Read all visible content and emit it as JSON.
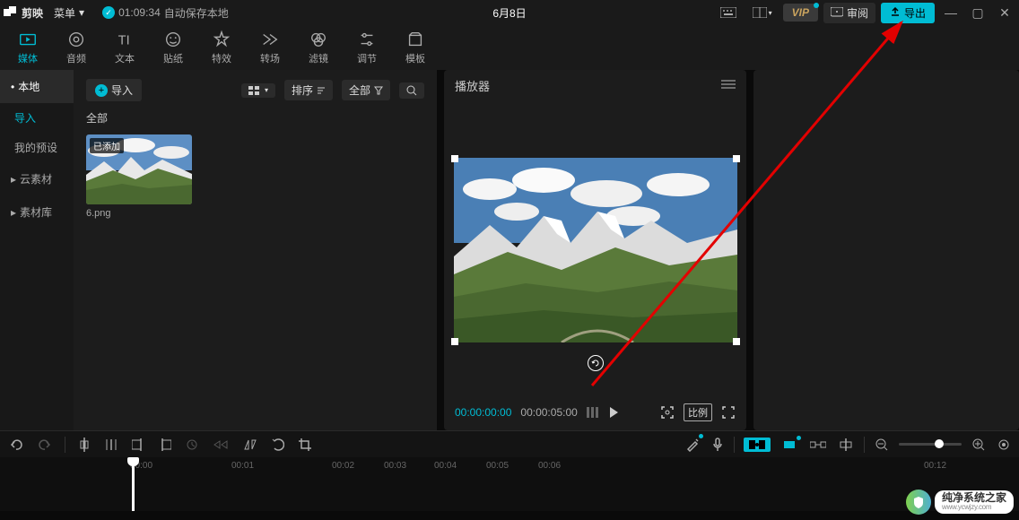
{
  "titlebar": {
    "app_name": "剪映",
    "menu_label": "菜单",
    "autosave_time": "01:09:34",
    "autosave_text": "自动保存本地",
    "project_title": "6月8日",
    "review_label": "审阅",
    "vip_label": "VIP",
    "export_label": "导出"
  },
  "ribbon": [
    {
      "label": "媒体",
      "active": true
    },
    {
      "label": "音频",
      "active": false
    },
    {
      "label": "文本",
      "active": false
    },
    {
      "label": "贴纸",
      "active": false
    },
    {
      "label": "特效",
      "active": false
    },
    {
      "label": "转场",
      "active": false
    },
    {
      "label": "滤镜",
      "active": false
    },
    {
      "label": "调节",
      "active": false
    },
    {
      "label": "模板",
      "active": false
    }
  ],
  "sidebar": {
    "items": [
      {
        "label": "本地",
        "expanded": true,
        "active": true
      },
      {
        "label": "导入",
        "sub": true,
        "active": true
      },
      {
        "label": "我的预设",
        "sub": true
      },
      {
        "label": "云素材",
        "expanded": false
      },
      {
        "label": "素材库",
        "expanded": false
      }
    ]
  },
  "media": {
    "import_label": "导入",
    "sort_label": "排序",
    "filter_label": "全部",
    "section": "全部",
    "thumb_badge": "已添加",
    "thumb_name": "6.png"
  },
  "player": {
    "title": "播放器",
    "time_current": "00:00:00:00",
    "time_total": "00:00:05:00",
    "ratio_label": "比例"
  },
  "timeline": {
    "marks": [
      "00:00",
      "00:01",
      "00:02",
      "00:03",
      "00:04",
      "00:05",
      "00:06",
      "00:12"
    ]
  },
  "watermark": {
    "name": "纯净系统之家",
    "url": "www.ycwjzy.com"
  }
}
